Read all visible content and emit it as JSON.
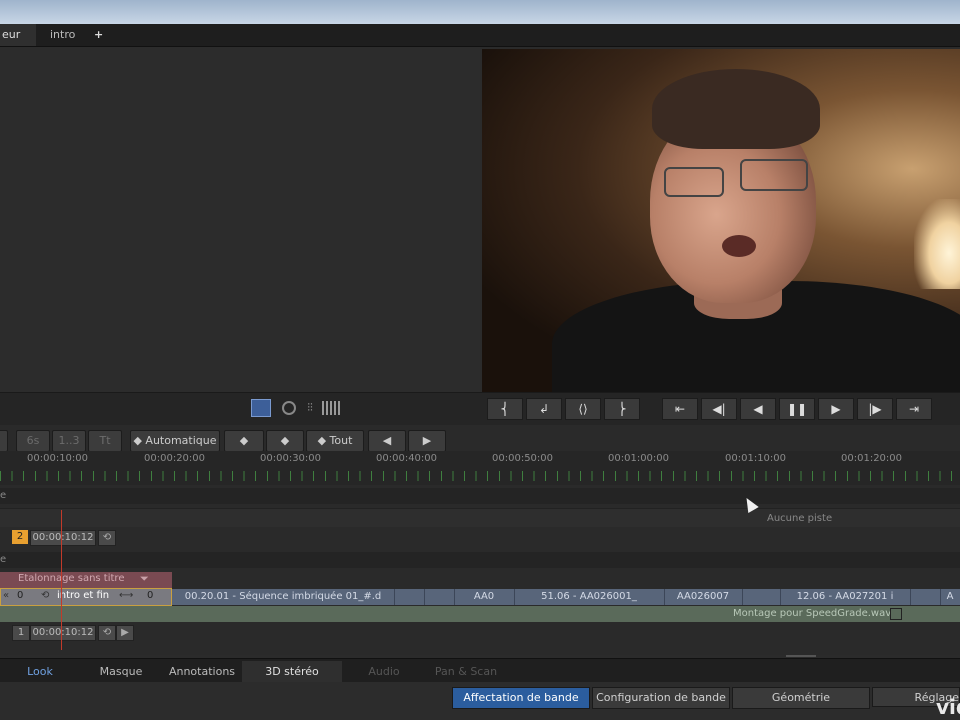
{
  "tabs": [
    {
      "label": "eur"
    },
    {
      "label": "intro"
    },
    {
      "label": "+"
    }
  ],
  "viewer_controls": {
    "left_icons": [
      "view-mode-icon",
      "scope-icon",
      "waveform-icon",
      "histogram-icon"
    ],
    "transport": [
      "mark-in-icon",
      "go-back-icon",
      "split-icon",
      "mark-out-icon",
      "go-start-icon",
      "step-back-icon",
      "play-back-icon",
      "pause-icon",
      "play-icon",
      "step-forward-icon",
      "go-end-icon"
    ]
  },
  "toolbar": {
    "fps_label": "6s",
    "range_label": "1..3",
    "tt_label": "Tt",
    "automatic_label": "◆ Automatique",
    "keyframe_label": "◆",
    "add_keyframe_label": "◆",
    "all_label": "◆ Tout",
    "prev_label": "◀",
    "next_label": "▶"
  },
  "ruler": {
    "labels": [
      "00:00:10:00",
      "00:00:20:00",
      "00:00:30:00",
      "00:00:40:00",
      "00:00:50:00",
      "00:01:00:00",
      "00:01:10:00",
      "00:01:20:00"
    ]
  },
  "tracks": {
    "section1_label": "e",
    "no_track_label": "Aucune piste",
    "track2_number": "2",
    "track2_timecode": "00:00:10:12",
    "section2_label": "e",
    "grade_label": "Etalonnage sans titre",
    "left_value": "0",
    "intro_label": "intro et fin",
    "right_value": "0",
    "clips": [
      {
        "label": "00.20.01 - Séquence imbriquée 01_#.d"
      },
      {
        "label": "AA0"
      },
      {
        "label": "51.06 - AA026001_"
      },
      {
        "label": "AA026007"
      },
      {
        "label": "12.06 - AA027201 i"
      },
      {
        "label": "A"
      }
    ],
    "audio_label": "Montage pour SpeedGrade.wav",
    "track1_number": "1",
    "track1_timecode": "00:00:10:12"
  },
  "bottom_tabs": [
    {
      "label": "Look"
    },
    {
      "label": "Masque"
    },
    {
      "label": "Annotations"
    },
    {
      "label": "3D stéréo"
    },
    {
      "label": "Audio"
    },
    {
      "label": "Pan & Scan"
    }
  ],
  "panel_buttons": [
    {
      "label": "Affectation de bande"
    },
    {
      "label": "Configuration de bande"
    },
    {
      "label": "Géométrie"
    },
    {
      "label": "Réglage"
    }
  ],
  "watermark": "vid",
  "colors": {
    "accent_blue": "#2b5d9e",
    "track_orange": "#e8a030",
    "playhead_red": "#c23a2a",
    "grade_bar": "#7a4a52",
    "clip_blue": "#58657a"
  }
}
